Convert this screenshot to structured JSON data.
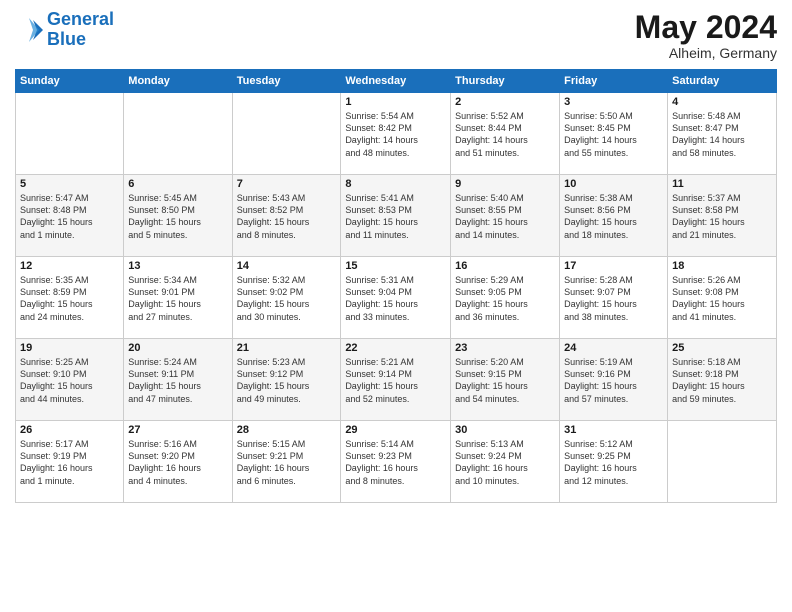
{
  "header": {
    "logo_line1": "General",
    "logo_line2": "Blue",
    "month": "May 2024",
    "location": "Alheim, Germany"
  },
  "weekdays": [
    "Sunday",
    "Monday",
    "Tuesday",
    "Wednesday",
    "Thursday",
    "Friday",
    "Saturday"
  ],
  "weeks": [
    [
      {
        "day": "",
        "info": ""
      },
      {
        "day": "",
        "info": ""
      },
      {
        "day": "",
        "info": ""
      },
      {
        "day": "1",
        "info": "Sunrise: 5:54 AM\nSunset: 8:42 PM\nDaylight: 14 hours\nand 48 minutes."
      },
      {
        "day": "2",
        "info": "Sunrise: 5:52 AM\nSunset: 8:44 PM\nDaylight: 14 hours\nand 51 minutes."
      },
      {
        "day": "3",
        "info": "Sunrise: 5:50 AM\nSunset: 8:45 PM\nDaylight: 14 hours\nand 55 minutes."
      },
      {
        "day": "4",
        "info": "Sunrise: 5:48 AM\nSunset: 8:47 PM\nDaylight: 14 hours\nand 58 minutes."
      }
    ],
    [
      {
        "day": "5",
        "info": "Sunrise: 5:47 AM\nSunset: 8:48 PM\nDaylight: 15 hours\nand 1 minute."
      },
      {
        "day": "6",
        "info": "Sunrise: 5:45 AM\nSunset: 8:50 PM\nDaylight: 15 hours\nand 5 minutes."
      },
      {
        "day": "7",
        "info": "Sunrise: 5:43 AM\nSunset: 8:52 PM\nDaylight: 15 hours\nand 8 minutes."
      },
      {
        "day": "8",
        "info": "Sunrise: 5:41 AM\nSunset: 8:53 PM\nDaylight: 15 hours\nand 11 minutes."
      },
      {
        "day": "9",
        "info": "Sunrise: 5:40 AM\nSunset: 8:55 PM\nDaylight: 15 hours\nand 14 minutes."
      },
      {
        "day": "10",
        "info": "Sunrise: 5:38 AM\nSunset: 8:56 PM\nDaylight: 15 hours\nand 18 minutes."
      },
      {
        "day": "11",
        "info": "Sunrise: 5:37 AM\nSunset: 8:58 PM\nDaylight: 15 hours\nand 21 minutes."
      }
    ],
    [
      {
        "day": "12",
        "info": "Sunrise: 5:35 AM\nSunset: 8:59 PM\nDaylight: 15 hours\nand 24 minutes."
      },
      {
        "day": "13",
        "info": "Sunrise: 5:34 AM\nSunset: 9:01 PM\nDaylight: 15 hours\nand 27 minutes."
      },
      {
        "day": "14",
        "info": "Sunrise: 5:32 AM\nSunset: 9:02 PM\nDaylight: 15 hours\nand 30 minutes."
      },
      {
        "day": "15",
        "info": "Sunrise: 5:31 AM\nSunset: 9:04 PM\nDaylight: 15 hours\nand 33 minutes."
      },
      {
        "day": "16",
        "info": "Sunrise: 5:29 AM\nSunset: 9:05 PM\nDaylight: 15 hours\nand 36 minutes."
      },
      {
        "day": "17",
        "info": "Sunrise: 5:28 AM\nSunset: 9:07 PM\nDaylight: 15 hours\nand 38 minutes."
      },
      {
        "day": "18",
        "info": "Sunrise: 5:26 AM\nSunset: 9:08 PM\nDaylight: 15 hours\nand 41 minutes."
      }
    ],
    [
      {
        "day": "19",
        "info": "Sunrise: 5:25 AM\nSunset: 9:10 PM\nDaylight: 15 hours\nand 44 minutes."
      },
      {
        "day": "20",
        "info": "Sunrise: 5:24 AM\nSunset: 9:11 PM\nDaylight: 15 hours\nand 47 minutes."
      },
      {
        "day": "21",
        "info": "Sunrise: 5:23 AM\nSunset: 9:12 PM\nDaylight: 15 hours\nand 49 minutes."
      },
      {
        "day": "22",
        "info": "Sunrise: 5:21 AM\nSunset: 9:14 PM\nDaylight: 15 hours\nand 52 minutes."
      },
      {
        "day": "23",
        "info": "Sunrise: 5:20 AM\nSunset: 9:15 PM\nDaylight: 15 hours\nand 54 minutes."
      },
      {
        "day": "24",
        "info": "Sunrise: 5:19 AM\nSunset: 9:16 PM\nDaylight: 15 hours\nand 57 minutes."
      },
      {
        "day": "25",
        "info": "Sunrise: 5:18 AM\nSunset: 9:18 PM\nDaylight: 15 hours\nand 59 minutes."
      }
    ],
    [
      {
        "day": "26",
        "info": "Sunrise: 5:17 AM\nSunset: 9:19 PM\nDaylight: 16 hours\nand 1 minute."
      },
      {
        "day": "27",
        "info": "Sunrise: 5:16 AM\nSunset: 9:20 PM\nDaylight: 16 hours\nand 4 minutes."
      },
      {
        "day": "28",
        "info": "Sunrise: 5:15 AM\nSunset: 9:21 PM\nDaylight: 16 hours\nand 6 minutes."
      },
      {
        "day": "29",
        "info": "Sunrise: 5:14 AM\nSunset: 9:23 PM\nDaylight: 16 hours\nand 8 minutes."
      },
      {
        "day": "30",
        "info": "Sunrise: 5:13 AM\nSunset: 9:24 PM\nDaylight: 16 hours\nand 10 minutes."
      },
      {
        "day": "31",
        "info": "Sunrise: 5:12 AM\nSunset: 9:25 PM\nDaylight: 16 hours\nand 12 minutes."
      },
      {
        "day": "",
        "info": ""
      }
    ]
  ]
}
